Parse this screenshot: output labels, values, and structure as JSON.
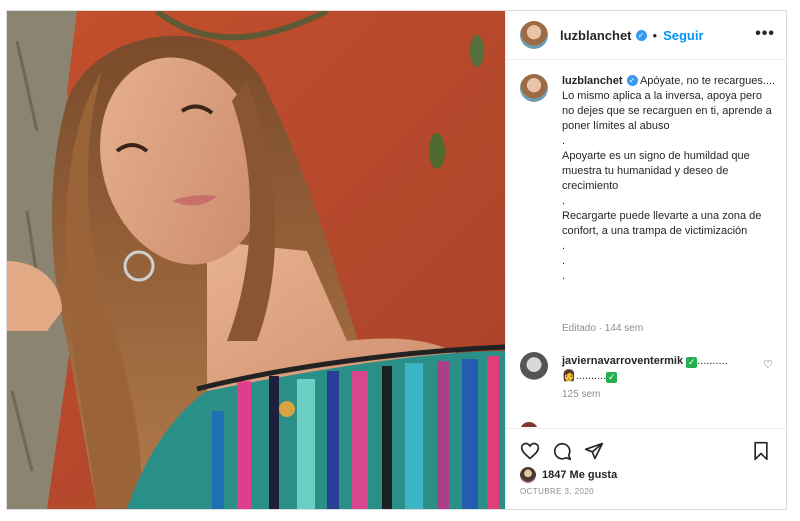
{
  "post": {
    "username": "luzblanchet",
    "follow_label": "Seguir",
    "dot": "•",
    "more_label": "•••"
  },
  "caption": {
    "username": "luzblanchet",
    "text": "Apóyate, no te recargues....\nLo mismo aplica a la inversa, apoya pero no dejes que se recarguen en ti, aprende a poner límites al abuso\n.\nApoyarte es un signo de humildad que muestra tu humanidad y deseo de crecimiento\n.\nRecargarte puede llevarte a una zona de confort, a una trampa de victimización\n.\n.\n.",
    "meta": "Editado · 144 sem"
  },
  "comment1": {
    "username": "javiernavarroventermik",
    "line1_suffix": "..........",
    "line2": "..........",
    "meta": "125 sem"
  },
  "footer": {
    "likes": "1847 Me gusta",
    "date": "OCTUBRE 3, 2020"
  },
  "colors": {
    "accent": "#0095f6",
    "verified": "#3897f0",
    "background_wall": "#c2512e"
  },
  "icons": [
    "verified-badge-icon",
    "more-options-icon",
    "heart-icon",
    "comment-icon",
    "share-icon",
    "bookmark-icon",
    "small-heart-icon",
    "check-emoji-icon",
    "person-emoji-icon"
  ]
}
